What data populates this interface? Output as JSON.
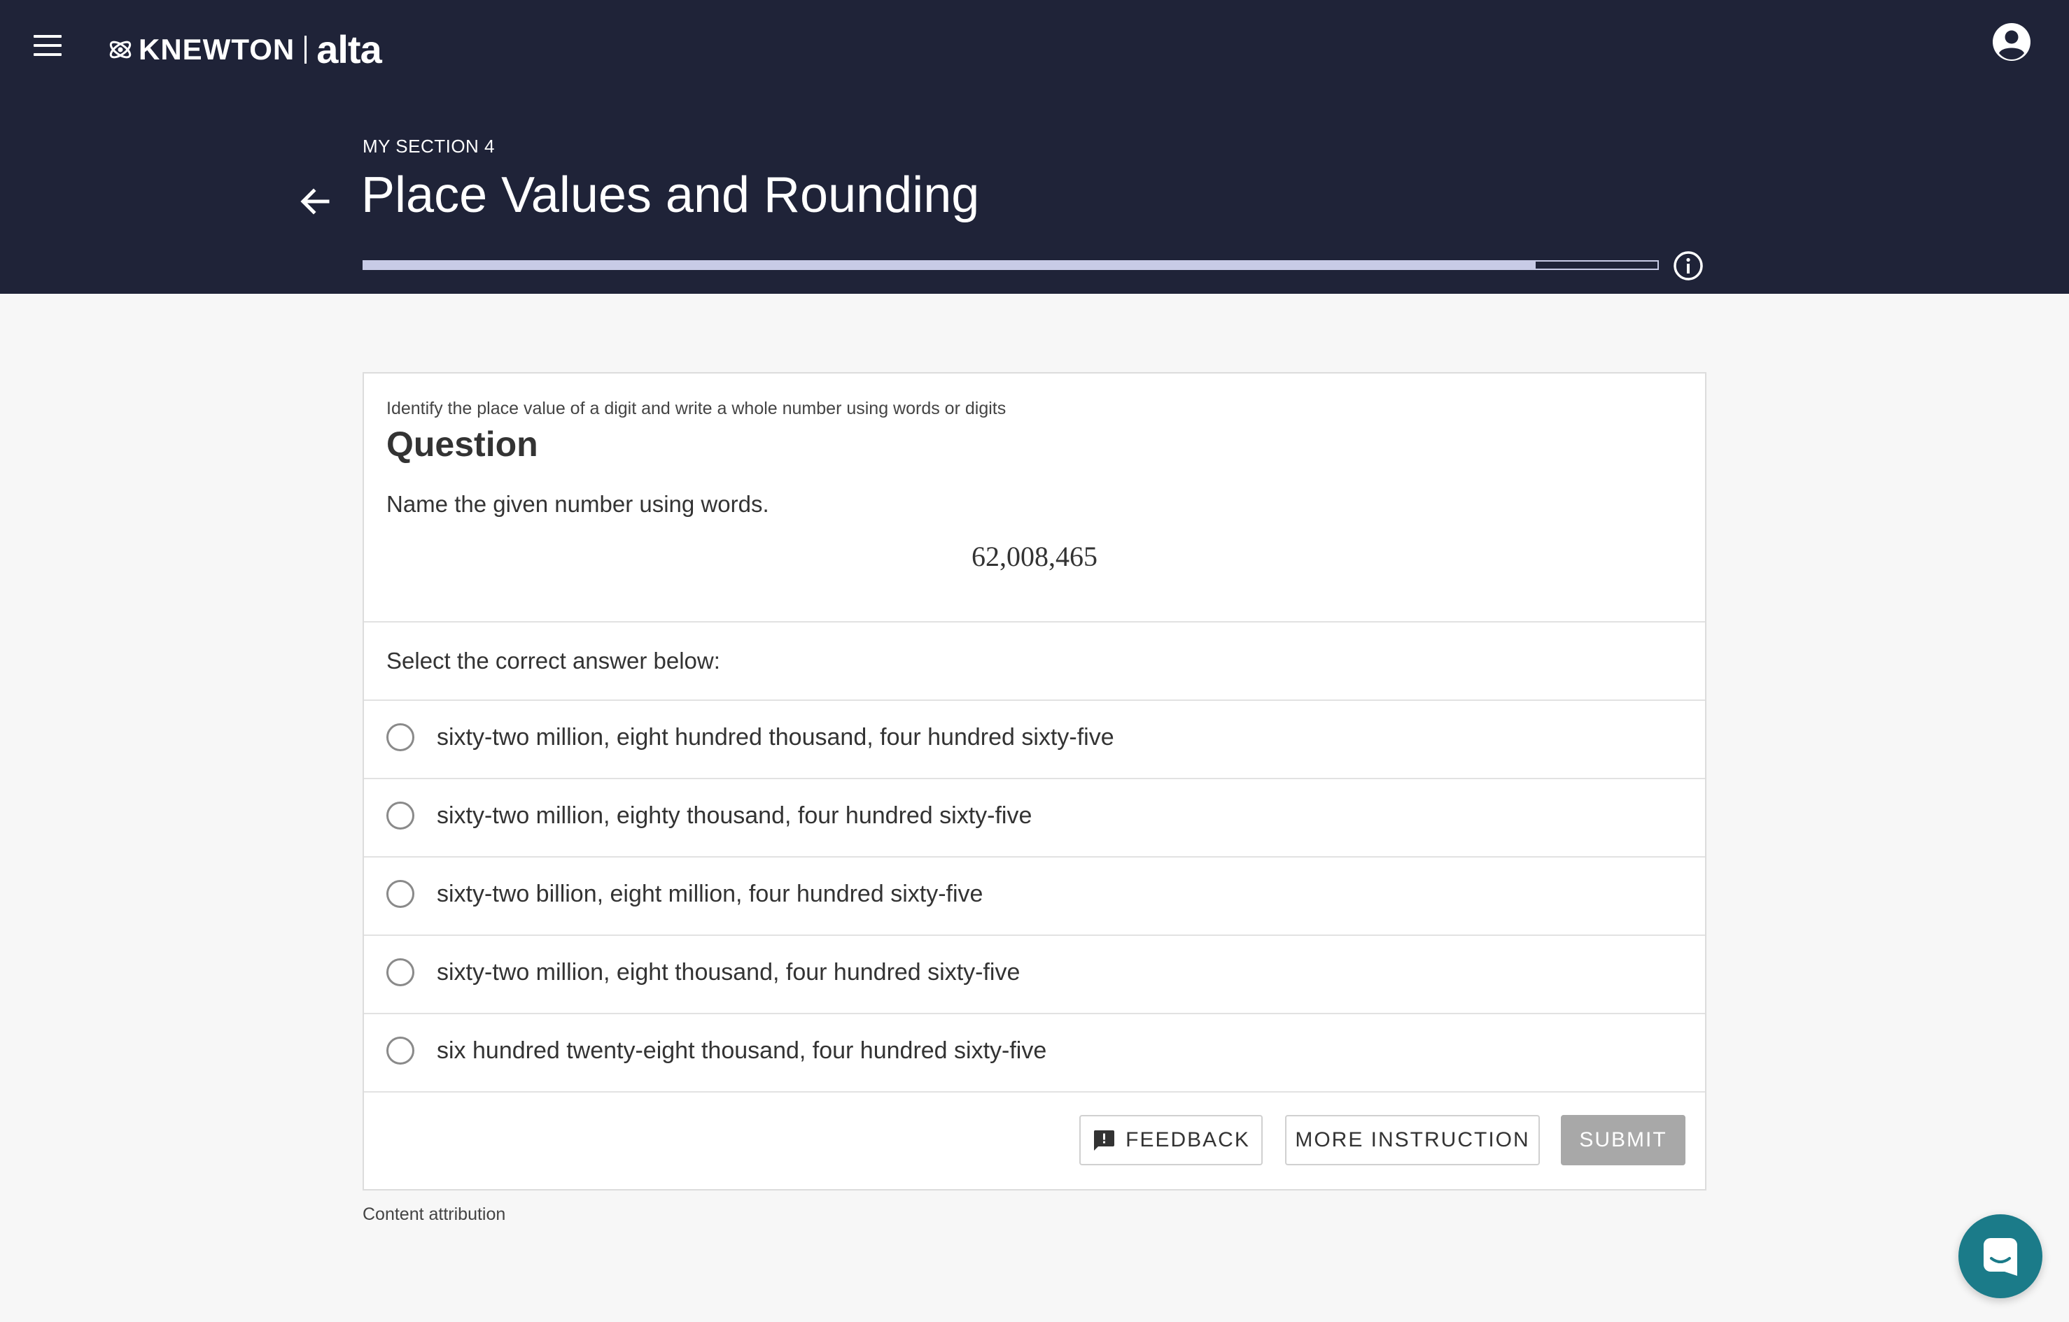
{
  "header": {
    "brand": "KNEWTON",
    "brand_product": "alta",
    "section_label": "MY SECTION 4",
    "title": "Place Values and Rounding",
    "progress_fraction": 0.906
  },
  "question": {
    "objective": "Identify the place value of a digit and write a whole number using words or digits",
    "heading": "Question",
    "prompt": "Name the given number using words.",
    "number": "62,008,465",
    "select_label": "Select the correct answer below:",
    "options": [
      "sixty-two million, eight hundred thousand, four hundred sixty-five",
      "sixty-two million, eighty thousand, four hundred sixty-five",
      "sixty-two billion, eight million, four hundred sixty-five",
      "sixty-two million, eight thousand, four hundred sixty-five",
      "six hundred twenty-eight thousand, four hundred sixty-five"
    ]
  },
  "actions": {
    "feedback": "FEEDBACK",
    "more_instruction": "MORE INSTRUCTION",
    "submit": "SUBMIT"
  },
  "footer": {
    "attribution": "Content attribution"
  },
  "colors": {
    "header_bg": "#1f2338",
    "progress": "#c8cbe6",
    "submit_disabled": "#a8a8a8",
    "chat_button": "#1b7b89"
  },
  "icons": [
    "menu-icon",
    "knewton-logo-icon",
    "account-icon",
    "back-arrow-icon",
    "info-icon",
    "radio-icon",
    "feedback-icon",
    "chat-icon"
  ]
}
